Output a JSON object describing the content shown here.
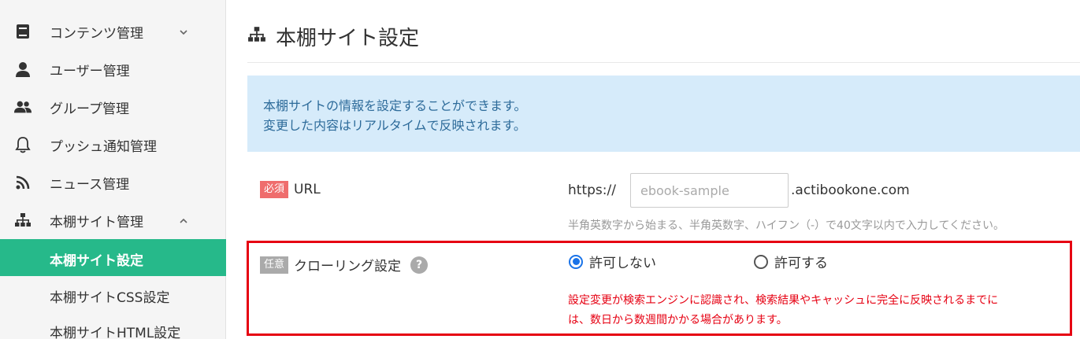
{
  "sidebar": {
    "items": [
      {
        "label": "コンテンツ管理",
        "icon": "book-icon",
        "chevron": "chevron-down"
      },
      {
        "label": "ユーザー管理",
        "icon": "user-icon"
      },
      {
        "label": "グループ管理",
        "icon": "users-icon"
      },
      {
        "label": "プッシュ通知管理",
        "icon": "bell-icon"
      },
      {
        "label": "ニュース管理",
        "icon": "rss-icon"
      },
      {
        "label": "本棚サイト管理",
        "icon": "sitemap-icon",
        "chevron": "chevron-up"
      }
    ],
    "subitems": [
      {
        "label": "本棚サイト設定",
        "active": true
      },
      {
        "label": "本棚サイトCSS設定"
      },
      {
        "label": "本棚サイトHTML設定"
      }
    ],
    "active_color": "#26b98a"
  },
  "header": {
    "title": "本棚サイト設定",
    "icon": "sitemap-icon"
  },
  "info": {
    "line1": "本棚サイトの情報を設定することができます。",
    "line2": "変更した内容はリアルタイムで反映されます。"
  },
  "url_setting": {
    "badge": "必須",
    "label": "URL",
    "prefix": "https://",
    "placeholder": "ebook-sample",
    "suffix": ".actibookone.com",
    "hint": "半角英数字から始まる、半角英数字、ハイフン（-）で40文字以内で入力してください。"
  },
  "crawl_setting": {
    "badge": "任意",
    "label": "クローリング設定",
    "help": "?",
    "options": [
      {
        "label": "許可しない",
        "selected": true
      },
      {
        "label": "許可する",
        "selected": false
      }
    ],
    "warning_line1": "設定変更が検索エンジンに認識され、検索結果やキャッシュに完全に反映されるまでに",
    "warning_line2": "は、数日から数週間かかる場合があります。"
  },
  "colors": {
    "required_badge": "#ef6d6d",
    "optional_badge": "#aaaaaa",
    "highlight_border": "#e60012",
    "info_bg": "#d6ebfa"
  }
}
